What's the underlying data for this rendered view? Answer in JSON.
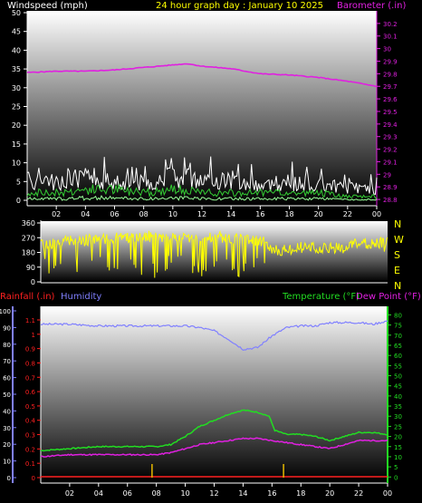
{
  "header": {
    "wind_label": "Windspeed (mph)",
    "title": "24 hour graph day : January 10 2025",
    "baro_label": "Barometer (.in)"
  },
  "lower_header": {
    "rain_label": "Rainfall (.in)",
    "humidity_label": "Humidity",
    "temp_label": "Temperature (°F)",
    "dew_label": "Dew Point (°F)"
  },
  "compass": [
    "N",
    "W",
    "S",
    "E",
    "N"
  ],
  "colors": {
    "windspeed": "#e6e6e6",
    "gust": "#ffffff",
    "wind_avg": "#33cc33",
    "barometer": "#e020e0",
    "direction": "#ffff00",
    "rain": "#ff2020",
    "humidity": "#8080ff",
    "temperature": "#22dd22",
    "dewpoint": "#e020e0",
    "rain_marks": "#e6b800",
    "panel_top": "#ffffff",
    "panel_bottom": "#000000"
  },
  "chart_data": [
    {
      "type": "line",
      "name": "wind-barometer",
      "x_ticks": [
        "02",
        "04",
        "06",
        "08",
        "10",
        "12",
        "14",
        "16",
        "18",
        "20",
        "22",
        "00"
      ],
      "y_left": {
        "label": "Windspeed (mph)",
        "ticks": [
          "0",
          "5",
          "10",
          "15",
          "20",
          "25",
          "30",
          "35",
          "40",
          "45",
          "50"
        ],
        "range": [
          0,
          50
        ]
      },
      "y_right": {
        "label": "Barometer (.in)",
        "ticks": [
          "28.8",
          "28.9",
          "29",
          "29.1",
          "29.2",
          "29.3",
          "29.4",
          "29.5",
          "29.6",
          "29.7",
          "29.8",
          "29.9",
          "30",
          "30.1",
          "30.2"
        ],
        "range": [
          28.75,
          30.3
        ]
      },
      "barometer": {
        "hours": [
          0,
          2,
          4,
          6,
          8,
          10,
          11,
          12,
          14,
          16,
          18,
          20,
          22,
          24
        ],
        "values": [
          29.81,
          29.82,
          29.82,
          29.83,
          29.85,
          29.87,
          29.88,
          29.86,
          29.84,
          29.8,
          29.79,
          29.77,
          29.74,
          29.7
        ]
      },
      "windspeed_envelope": {
        "hours": [
          0,
          2,
          4,
          6,
          8,
          10,
          12,
          14,
          16,
          18,
          20,
          22,
          24
        ],
        "max_gust": [
          8,
          7,
          9,
          8,
          7,
          9,
          8,
          8,
          6,
          7,
          6,
          5,
          4
        ],
        "avg": [
          2,
          2,
          3,
          3,
          2,
          3,
          2,
          2,
          2,
          2,
          2,
          1,
          1
        ]
      }
    },
    {
      "type": "line",
      "name": "wind-direction",
      "x_ticks": [],
      "y_left": {
        "ticks": [
          "360",
          "270",
          "180",
          "90",
          "0"
        ],
        "range": [
          0,
          360
        ]
      },
      "direction_profile": {
        "hours": [
          0,
          2,
          4,
          6,
          8,
          10,
          12,
          14,
          15.6,
          16,
          18,
          20,
          22,
          24
        ],
        "values": [
          225,
          250,
          260,
          270,
          280,
          270,
          275,
          260,
          250,
          190,
          210,
          200,
          230,
          240
        ]
      }
    },
    {
      "type": "line",
      "name": "temperature-humidity-rain",
      "x_ticks": [
        "02",
        "04",
        "06",
        "08",
        "10",
        "12",
        "14",
        "16",
        "18",
        "20",
        "22",
        "00"
      ],
      "y_humidity": {
        "label": "Humidity",
        "ticks": [
          "0",
          "10",
          "20",
          "30",
          "40",
          "50",
          "60",
          "70",
          "80",
          "90",
          "100"
        ],
        "range": [
          0,
          100
        ]
      },
      "y_rain": {
        "label": "Rainfall (.in)",
        "ticks": [
          "0",
          "0.1",
          "0.2",
          "0.3",
          "0.4",
          "0.5",
          "0.6",
          "0.7",
          "0.8",
          "0.9",
          "1",
          "1.1"
        ],
        "range": [
          0,
          1.1
        ]
      },
      "y_temp": {
        "label": "Temperature (°F)",
        "ticks": [
          "0",
          "5",
          "10",
          "15",
          "20",
          "25",
          "30",
          "35",
          "40",
          "45",
          "50",
          "55",
          "60",
          "65",
          "70",
          "75",
          "80"
        ],
        "range": [
          -3,
          82
        ]
      },
      "humidity": {
        "hours": [
          0,
          2,
          4,
          6,
          8,
          10,
          11,
          12,
          13,
          13.5,
          14,
          15,
          16,
          17,
          18,
          19,
          20,
          21,
          22,
          23,
          24
        ],
        "values": [
          92,
          92,
          91,
          91,
          91,
          91,
          90,
          88,
          83,
          80,
          77,
          78,
          85,
          90,
          91,
          91,
          93,
          93,
          93,
          92,
          94
        ]
      },
      "temperature": {
        "hours": [
          0,
          2,
          4,
          6,
          8,
          9,
          10,
          11,
          12,
          13,
          14,
          15,
          15.8,
          16.2,
          17,
          18,
          19,
          20,
          21,
          22,
          23,
          24
        ],
        "values": [
          13,
          14,
          15,
          15,
          15,
          16,
          20,
          25,
          28,
          31,
          33,
          32,
          30,
          23,
          21,
          21,
          20,
          18,
          20,
          22,
          22,
          21
        ]
      },
      "dewpoint": {
        "hours": [
          0,
          2,
          4,
          6,
          8,
          9,
          10,
          11,
          12,
          13,
          14,
          15,
          16,
          17,
          18,
          19,
          20,
          21,
          22,
          23,
          24
        ],
        "values": [
          10,
          11,
          11,
          11,
          11,
          12,
          14,
          16,
          17,
          18,
          19,
          19,
          18,
          17,
          16,
          15,
          14,
          16,
          18,
          18,
          18
        ]
      },
      "rainfall": {
        "hours": [
          0,
          24
        ],
        "values": [
          0,
          0
        ]
      },
      "rain_marks_hours": [
        7.7,
        16.8
      ]
    }
  ]
}
